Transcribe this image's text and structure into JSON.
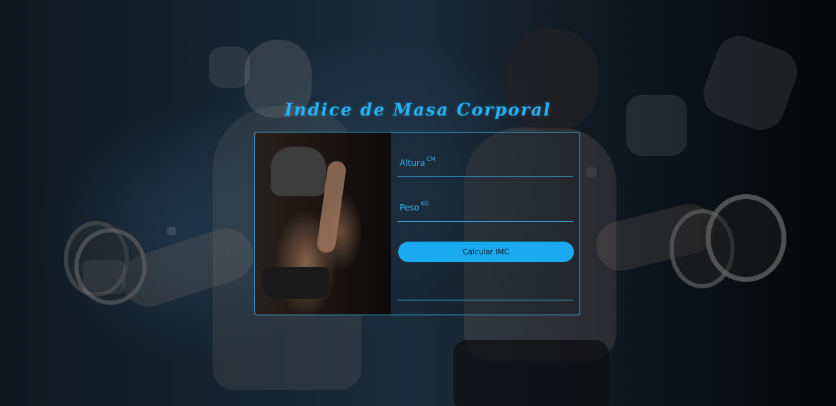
{
  "page": {
    "title": "Indice de Masa Corporal"
  },
  "form": {
    "altura": {
      "label": "Altura",
      "unit": "CM"
    },
    "peso": {
      "label": "Peso",
      "unit": "KG"
    },
    "button_label": "Calcular IMC",
    "result": ""
  },
  "colors": {
    "accent": "#1aaaf0",
    "title": "#2ab0f0",
    "border": "#3aa6e0"
  }
}
